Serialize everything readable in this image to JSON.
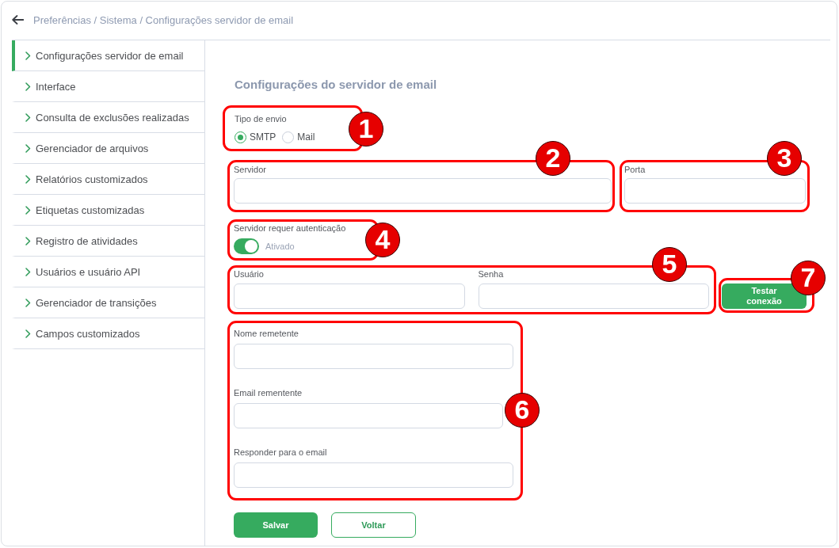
{
  "header": {
    "breadcrumb": "Preferências / Sistema / Configurações servidor de email"
  },
  "sidebar": {
    "items": [
      {
        "label": "Configurações servidor de email",
        "selected": true
      },
      {
        "label": "Interface",
        "selected": false
      },
      {
        "label": "Consulta de exclusões realizadas",
        "selected": false
      },
      {
        "label": "Gerenciador de arquivos",
        "selected": false
      },
      {
        "label": "Relatórios customizados",
        "selected": false
      },
      {
        "label": "Etiquetas customizadas",
        "selected": false
      },
      {
        "label": "Registro de atividades",
        "selected": false
      },
      {
        "label": "Usuários e usuário API",
        "selected": false
      },
      {
        "label": "Gerenciador de transições",
        "selected": false
      },
      {
        "label": "Campos customizados",
        "selected": false
      }
    ]
  },
  "form": {
    "title": "Configurações do servidor de email",
    "send_type": {
      "callout": "1",
      "label": "Tipo de envio",
      "options": [
        {
          "label": "SMTP",
          "selected": true
        },
        {
          "label": "Mail",
          "selected": false
        }
      ]
    },
    "server": {
      "callout": "2",
      "label": "Servidor"
    },
    "port": {
      "callout": "3",
      "label": "Porta"
    },
    "auth": {
      "callout": "4",
      "label": "Servidor requer autenticação",
      "on": true,
      "state_label": "Ativado"
    },
    "credentials": {
      "callout": "5",
      "fields": [
        {
          "label": "Usuário"
        },
        {
          "label": "Senha"
        }
      ]
    },
    "test_button": {
      "callout": "7",
      "label": "Testar conexão"
    },
    "sender": {
      "callout": "6",
      "fields": [
        {
          "label": "Nome remetente"
        },
        {
          "label": "Email rementente"
        },
        {
          "label": "Responder para o email"
        }
      ]
    },
    "buttons": [
      {
        "label": "Salvar",
        "kind": "primary"
      },
      {
        "label": "Voltar",
        "kind": "secondary"
      }
    ]
  }
}
